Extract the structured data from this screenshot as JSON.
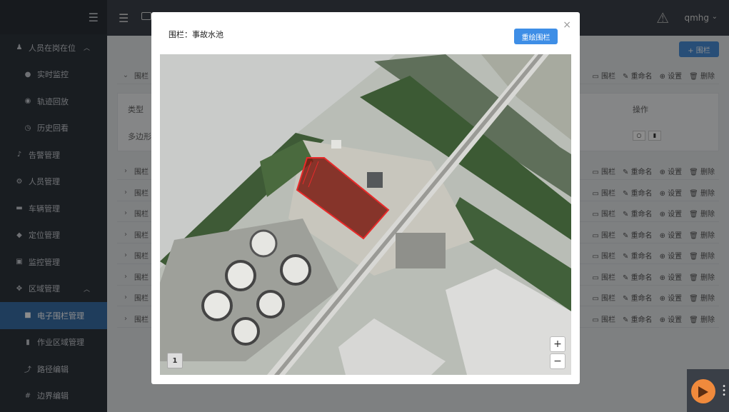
{
  "sidebar": {
    "items": [
      {
        "label": "人员在岗在位",
        "icon": "person-icon",
        "chevron": "^"
      },
      {
        "label": "实时监控",
        "icon": "location-pin-icon"
      },
      {
        "label": "轨迹回放",
        "icon": "play-circle-icon"
      },
      {
        "label": "历史回看",
        "icon": "history-icon"
      },
      {
        "label": "告警管理",
        "icon": "bell-icon"
      },
      {
        "label": "人员管理",
        "icon": "gear-icon"
      },
      {
        "label": "车辆管理",
        "icon": "car-icon"
      },
      {
        "label": "定位管理",
        "icon": "tag-icon"
      },
      {
        "label": "监控管理",
        "icon": "camera-icon"
      },
      {
        "label": "区域管理",
        "icon": "move-icon",
        "chevron": "^"
      },
      {
        "label": "电子围栏管理",
        "icon": "fence-icon"
      },
      {
        "label": "作业区域管理",
        "icon": "book-icon"
      },
      {
        "label": "路径编辑",
        "icon": "route-icon"
      },
      {
        "label": "边界编辑",
        "icon": "hash-icon"
      }
    ]
  },
  "topbar": {
    "username": "qmhg"
  },
  "content": {
    "add_button": "+ 围栏",
    "row_label": "围栏",
    "actions": {
      "fence": "围栏",
      "rename": "重命名",
      "settings": "设置",
      "delete": "删除"
    },
    "detail": {
      "col_type": "类型",
      "col_polygon": "多边形",
      "col_ops": "操作"
    }
  },
  "modal": {
    "title": "围栏：事故水池",
    "redraw_button": "重绘围栏",
    "close": "×",
    "zoom_in": "+",
    "zoom_out": "−",
    "page_badge": "1"
  },
  "colors": {
    "accent": "#3e8ee6",
    "fence_fill": "#7a1a10",
    "fence_stroke": "#e82a2a"
  }
}
